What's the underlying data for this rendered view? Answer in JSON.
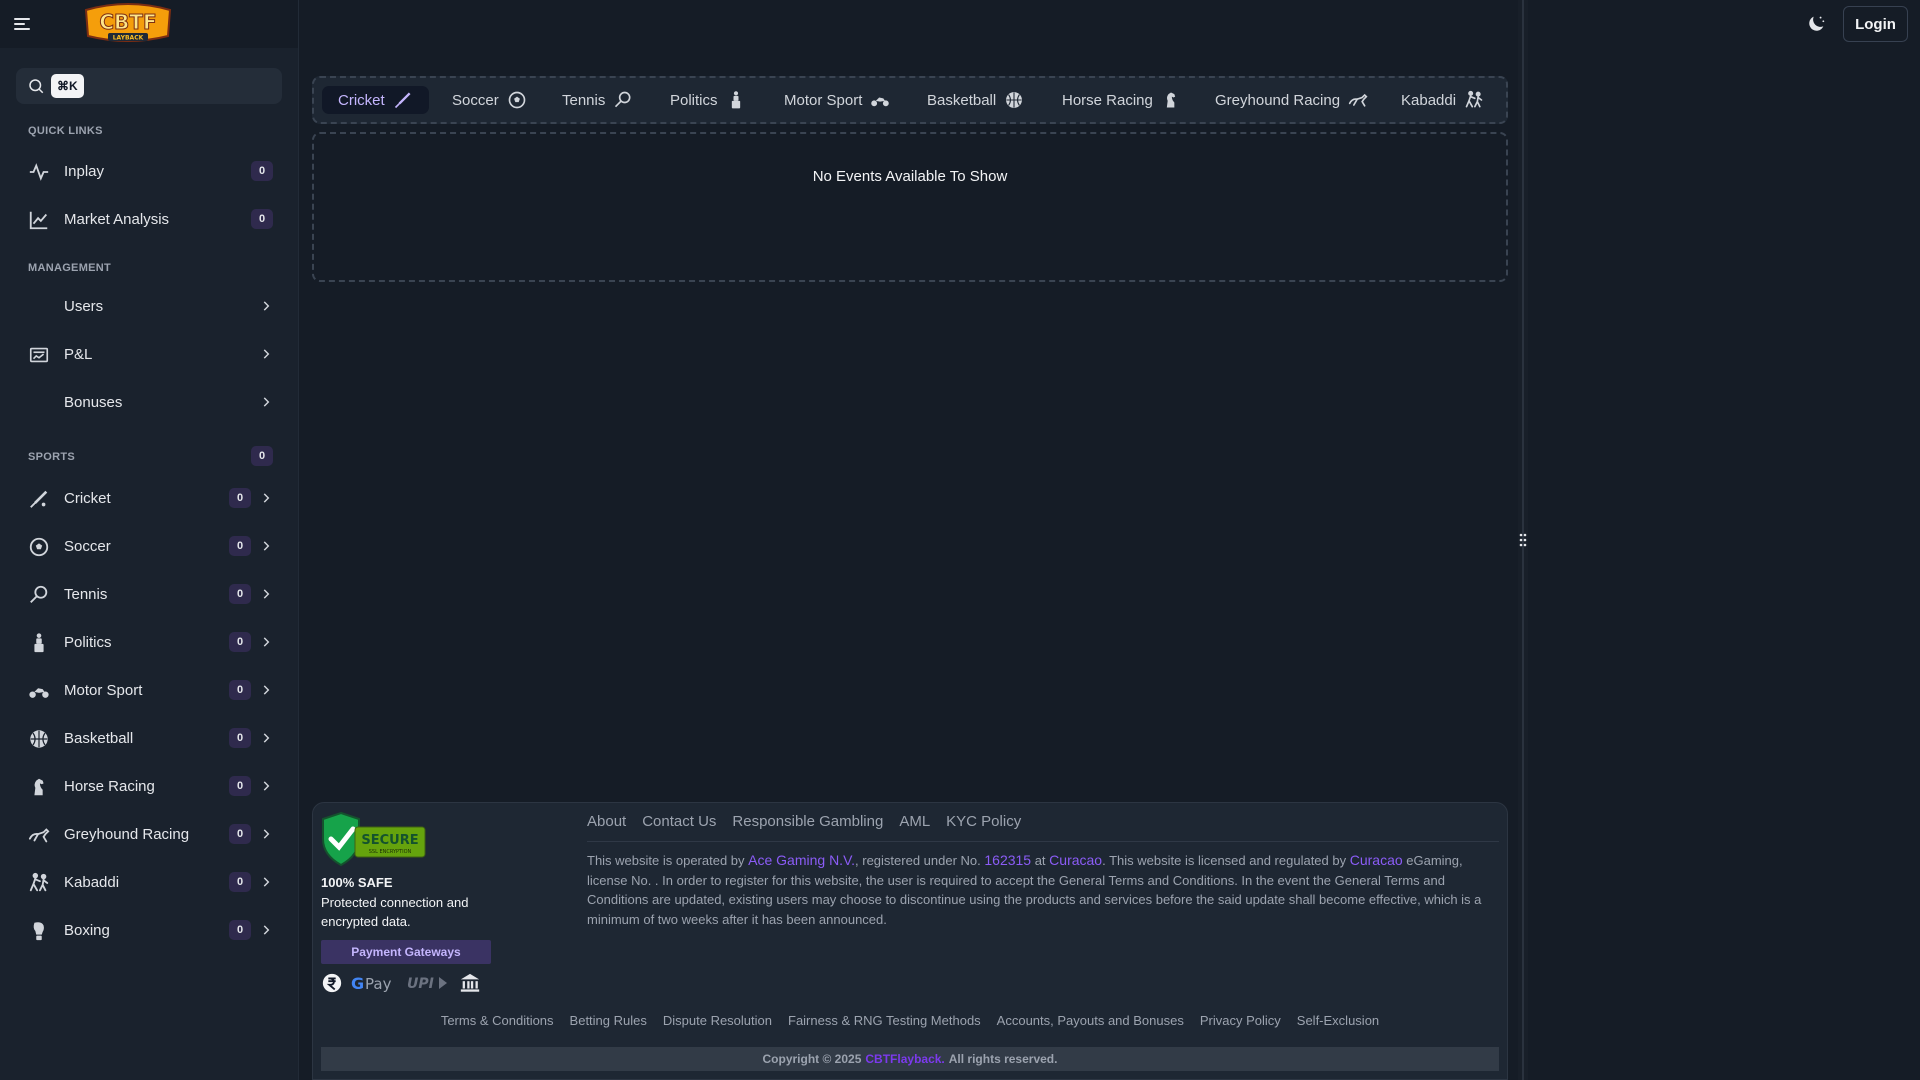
{
  "topbar": {
    "logo_text": "CBTF",
    "logo_sub": "LAYBACK",
    "login_label": "Login"
  },
  "search": {
    "shortcut": "⌘K"
  },
  "sidebar": {
    "quick_links_title": "QUICK LINKS",
    "quick_links": [
      {
        "label": "Inplay",
        "count": "0",
        "icon": "activity-icon"
      },
      {
        "label": "Market Analysis",
        "count": "0",
        "icon": "chart-line-icon"
      }
    ],
    "management_title": "MANAGEMENT",
    "management": [
      {
        "label": "Users"
      },
      {
        "label": "P&L",
        "icon": "pnl-icon"
      },
      {
        "label": "Bonuses"
      }
    ],
    "sports_title": "SPORTS",
    "sports_count": "0",
    "sports": [
      {
        "label": "Cricket",
        "count": "0",
        "icon": "cricket-icon"
      },
      {
        "label": "Soccer",
        "count": "0",
        "icon": "soccer-ball-icon"
      },
      {
        "label": "Tennis",
        "count": "0",
        "icon": "tennis-racket-icon"
      },
      {
        "label": "Politics",
        "count": "0",
        "icon": "podium-icon"
      },
      {
        "label": "Motor Sport",
        "count": "0",
        "icon": "motorbike-icon"
      },
      {
        "label": "Basketball",
        "count": "0",
        "icon": "basketball-icon"
      },
      {
        "label": "Horse Racing",
        "count": "0",
        "icon": "horse-icon"
      },
      {
        "label": "Greyhound Racing",
        "count": "0",
        "icon": "greyhound-icon"
      },
      {
        "label": "Kabaddi",
        "count": "0",
        "icon": "kabaddi-icon"
      },
      {
        "label": "Boxing",
        "count": "0",
        "icon": "boxing-glove-icon"
      }
    ]
  },
  "tabs": [
    {
      "label": "Cricket",
      "active": true
    },
    {
      "label": "Soccer"
    },
    {
      "label": "Tennis"
    },
    {
      "label": "Politics"
    },
    {
      "label": "Motor Sport"
    },
    {
      "label": "Basketball"
    },
    {
      "label": "Horse Racing"
    },
    {
      "label": "Greyhound Racing"
    },
    {
      "label": "Kabaddi"
    }
  ],
  "events": {
    "empty_message": "No Events Available To Show"
  },
  "footer": {
    "secure_badge_text": "SECURE",
    "secure_badge_sub": "SSL ENCRYPTION",
    "safe_title": "100% SAFE",
    "safe_text": "Protected connection and encrypted data.",
    "payment_gateways_label": "Payment Gateways",
    "gpay_label": "G Pay",
    "upi_label": "UPI",
    "links": [
      "About",
      "Contact Us",
      "Responsible Gambling",
      "AML",
      "KYC Policy"
    ],
    "para_1": "This website is operated by ",
    "operator": "Ace Gaming N.V.",
    "para_2": ", registered under No. ",
    "reg_no": "162315",
    "para_3": " at ",
    "place": "Curacao",
    "para_4": ". This website is licensed and regulated by ",
    "regulator": "Curacao",
    "para_5": " eGaming, license No. . In order to register for this website, the user is required to accept the General Terms and Conditions. In the event the General Terms and Conditions are updated, existing users may choose to discontinue using the products and services before the said update shall become effective, which is a minimum of two weeks after it has been announced.",
    "bottom_links": [
      "Terms & Conditions",
      "Betting Rules",
      "Dispute Resolution",
      "Fairness & RNG Testing Methods",
      "Accounts, Payouts and Bonuses",
      "Privacy Policy",
      "Self-Exclusion"
    ],
    "copyright_prefix": "Copyright © 2025",
    "brand": "CBTFlayback.",
    "rights": "All rights reserved."
  },
  "colors": {
    "accent": "#8b5cf6",
    "background": "#151c26",
    "sidebar": "#1a222d"
  }
}
